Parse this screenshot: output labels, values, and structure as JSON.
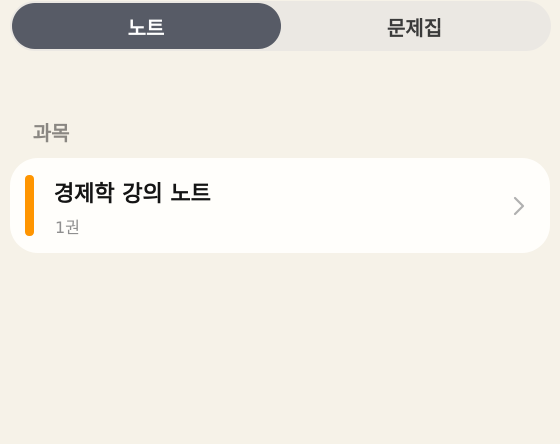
{
  "tabs": {
    "notes_label": "노트",
    "question_bank_label": "문제집"
  },
  "section": {
    "title": "과목"
  },
  "subjects": [
    {
      "title": "경제학 강의 노트",
      "count": "1권",
      "color": "#ff9500"
    }
  ],
  "icons": {
    "chevron": "chevron-right-icon"
  }
}
